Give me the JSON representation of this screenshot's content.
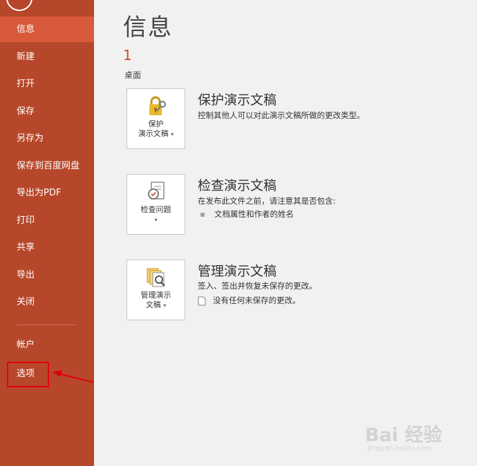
{
  "sidebar": {
    "items": [
      {
        "label": "信息",
        "active": true
      },
      {
        "label": "新建"
      },
      {
        "label": "打开"
      },
      {
        "label": "保存"
      },
      {
        "label": "另存为"
      },
      {
        "label": "保存到百度网盘"
      },
      {
        "label": "导出为PDF"
      },
      {
        "label": "打印"
      },
      {
        "label": "共享"
      },
      {
        "label": "导出"
      },
      {
        "label": "关闭"
      }
    ],
    "footer_items": [
      {
        "label": "帐户"
      },
      {
        "label": "选项"
      }
    ]
  },
  "main": {
    "title": "信息",
    "doc_index": "1",
    "doc_location": "桌面",
    "sections": [
      {
        "button_line1": "保护",
        "button_line2": "演示文稿",
        "title": "保护演示文稿",
        "desc": "控制其他人可以对此演示文稿所做的更改类型。"
      },
      {
        "button_line1": "检查问题",
        "title": "检查演示文稿",
        "desc": "在发布此文件之前，请注意其是否包含:",
        "bullet": "文档属性和作者的姓名"
      },
      {
        "button_line1": "管理演示",
        "button_line2": "文稿",
        "title": "管理演示文稿",
        "desc": "签入、签出并恢复未保存的更改。",
        "sub": "没有任何未保存的更改。"
      }
    ]
  },
  "watermark": {
    "brand": "Bai 经验",
    "url": "jingyan.baidu.com"
  },
  "colors": {
    "sidebar": "#b7472a",
    "active": "#d85a3b",
    "accent": "#d24726",
    "highlight": "#e0000f"
  }
}
